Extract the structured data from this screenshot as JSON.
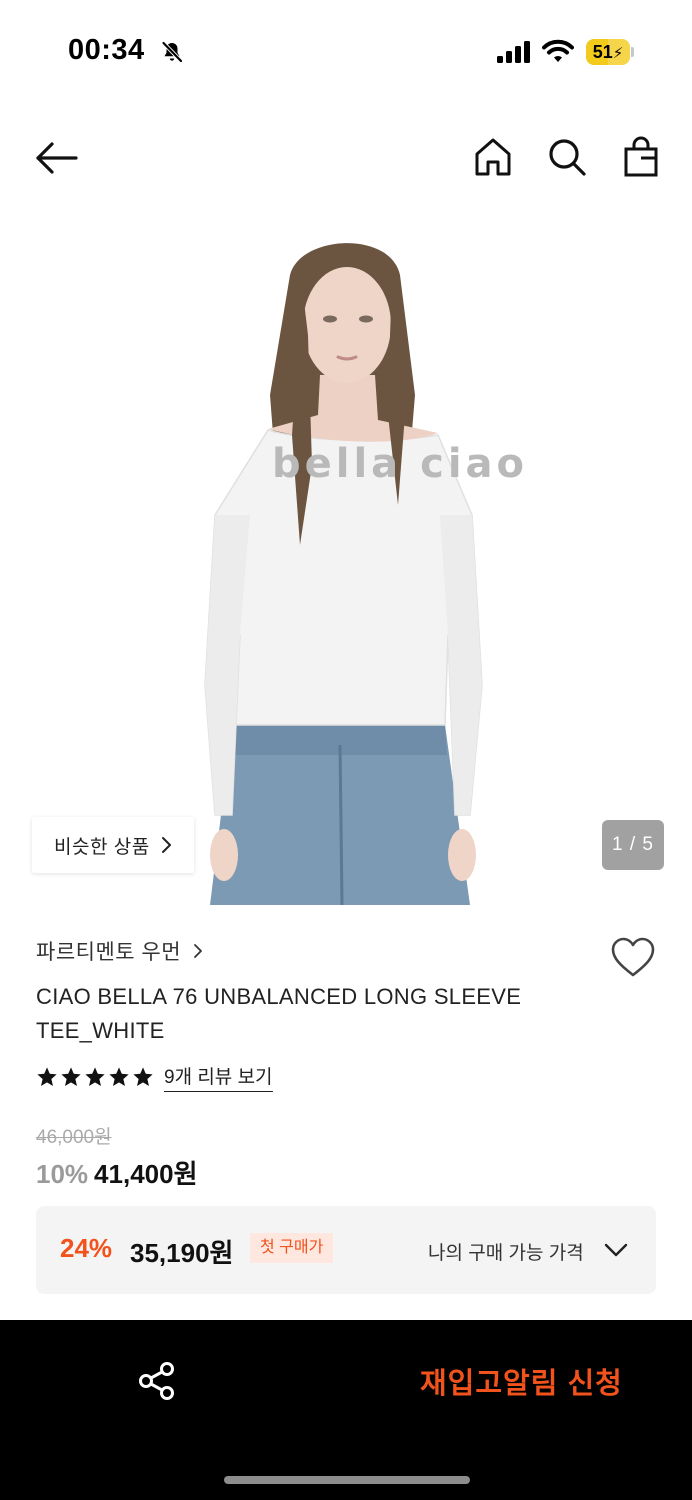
{
  "status_bar": {
    "time": "00:34",
    "battery": "51",
    "battery_level": 0.51,
    "icons": [
      "bell-slash-icon",
      "signal-icon",
      "wifi-icon",
      "battery-charging-icon"
    ]
  },
  "header": {
    "icons": [
      "back-arrow-icon",
      "home-icon",
      "search-icon",
      "shopping-bag-icon"
    ]
  },
  "gallery": {
    "similar_label": "비슷한 상품",
    "page_indicator": "1 / 5",
    "photo_text": "bella ciao"
  },
  "product": {
    "brand": "파르티멘토 우먼",
    "title": "CIAO BELLA 76 UNBALANCED LONG SLEEVE TEE_WHITE",
    "rating_stars": 5,
    "review_link": "9개 리뷰 보기",
    "original_price": "46,000원",
    "discount_rate": "10%",
    "sale_price": "41,400원"
  },
  "my_price": {
    "rate": "24%",
    "price": "35,190원",
    "badge": "첫 구매가",
    "label": "나의 구매 가능 가격"
  },
  "bottom_bar": {
    "restock_label": "재입고알림 신청"
  },
  "colors": {
    "accent": "#f2521c",
    "badge_bg": "#fde7df",
    "bottom_bar": "#000000",
    "box_bg": "#f4f4f4"
  }
}
